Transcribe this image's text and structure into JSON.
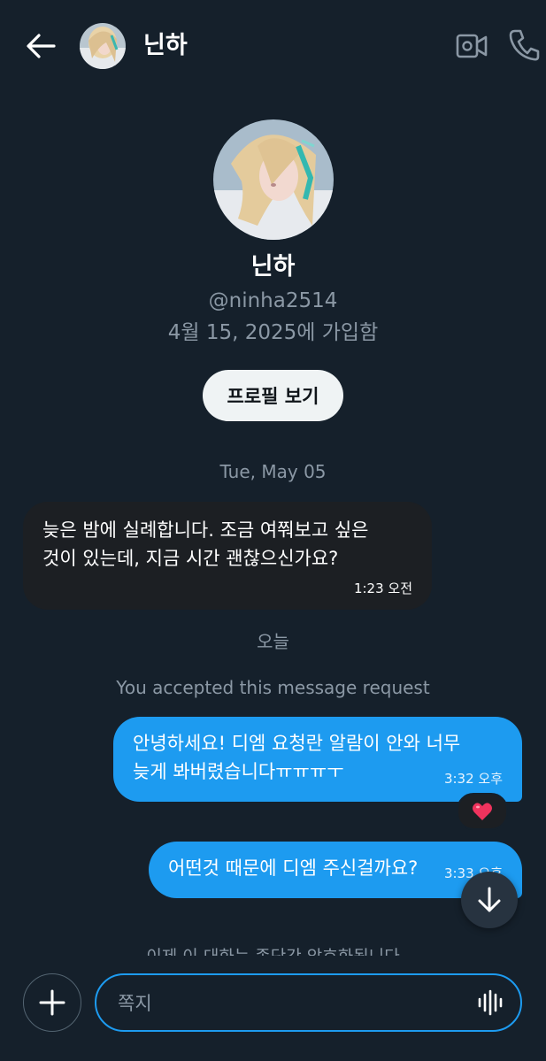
{
  "header": {
    "name": "닌하"
  },
  "profile": {
    "name": "닌하",
    "handle": "@ninha2514",
    "joined": "4월 15, 2025에 가입함",
    "view_profile_label": "프로필 보기"
  },
  "messages": {
    "date_1": "Tue, May 05",
    "incoming_1": {
      "text": "늦은 밤에 실례합니다. 조금 여쭤보고 싶은\n것이 있는데, 지금 시간 괜찮으신가요?",
      "time": "1:23 오전"
    },
    "date_2": "오늘",
    "accepted_note": "You accepted this message request",
    "outgoing_1": {
      "text": "안녕하세요! 디엠 요청란 알람이 안와 너무\n늦게 봐버렸습니다ㅠㅠㅠㅜ",
      "time": "3:32 오후",
      "reaction": "❤️"
    },
    "outgoing_2": {
      "text": "어떤것 때문에 디엠 주신걸까요?",
      "time": "3:33 오후"
    },
    "faded_note": "이제 이 대화는 종단간 암호화됩니다"
  },
  "composer": {
    "placeholder": "쪽지"
  },
  "icons": {
    "back": "arrow-left-icon",
    "video": "video-camera-icon",
    "call": "phone-icon",
    "add": "plus-icon",
    "voice": "voice-waveform-icon",
    "scroll": "arrow-down-icon"
  },
  "colors": {
    "background": "#15202b",
    "accent": "#1d9bf0",
    "incoming_bubble": "#1c1f23",
    "muted_text": "#8b98a5"
  }
}
